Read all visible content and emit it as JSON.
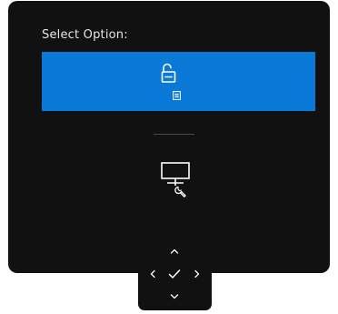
{
  "dialog": {
    "prompt": "Select Option:"
  },
  "options": [
    {
      "name": "unlock",
      "icon": "unlock-icon",
      "sub_icon": "menu-icon",
      "selected": true
    },
    {
      "name": "monitor-settings",
      "icon": "monitor-icon",
      "sub_icon": "wrench-icon",
      "selected": false
    }
  ],
  "joystick": {
    "up_icon": "chevron-up-icon",
    "down_icon": "chevron-down-icon",
    "left_icon": "chevron-left-icon",
    "right_icon": "chevron-right-icon",
    "ok_icon": "check-icon"
  },
  "colors": {
    "panel_background": "#111111",
    "selected_background": "#0a78d7",
    "text": "#e6e6e6",
    "icon": "#ffffff"
  }
}
